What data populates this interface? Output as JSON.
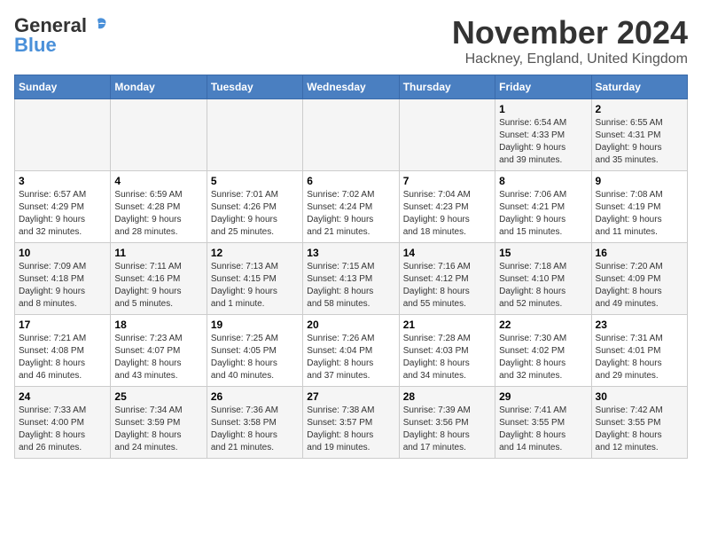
{
  "header": {
    "logo_general": "General",
    "logo_blue": "Blue",
    "title": "November 2024",
    "location": "Hackney, England, United Kingdom"
  },
  "weekdays": [
    "Sunday",
    "Monday",
    "Tuesday",
    "Wednesday",
    "Thursday",
    "Friday",
    "Saturday"
  ],
  "weeks": [
    [
      {
        "day": "",
        "info": ""
      },
      {
        "day": "",
        "info": ""
      },
      {
        "day": "",
        "info": ""
      },
      {
        "day": "",
        "info": ""
      },
      {
        "day": "",
        "info": ""
      },
      {
        "day": "1",
        "info": "Sunrise: 6:54 AM\nSunset: 4:33 PM\nDaylight: 9 hours\nand 39 minutes."
      },
      {
        "day": "2",
        "info": "Sunrise: 6:55 AM\nSunset: 4:31 PM\nDaylight: 9 hours\nand 35 minutes."
      }
    ],
    [
      {
        "day": "3",
        "info": "Sunrise: 6:57 AM\nSunset: 4:29 PM\nDaylight: 9 hours\nand 32 minutes."
      },
      {
        "day": "4",
        "info": "Sunrise: 6:59 AM\nSunset: 4:28 PM\nDaylight: 9 hours\nand 28 minutes."
      },
      {
        "day": "5",
        "info": "Sunrise: 7:01 AM\nSunset: 4:26 PM\nDaylight: 9 hours\nand 25 minutes."
      },
      {
        "day": "6",
        "info": "Sunrise: 7:02 AM\nSunset: 4:24 PM\nDaylight: 9 hours\nand 21 minutes."
      },
      {
        "day": "7",
        "info": "Sunrise: 7:04 AM\nSunset: 4:23 PM\nDaylight: 9 hours\nand 18 minutes."
      },
      {
        "day": "8",
        "info": "Sunrise: 7:06 AM\nSunset: 4:21 PM\nDaylight: 9 hours\nand 15 minutes."
      },
      {
        "day": "9",
        "info": "Sunrise: 7:08 AM\nSunset: 4:19 PM\nDaylight: 9 hours\nand 11 minutes."
      }
    ],
    [
      {
        "day": "10",
        "info": "Sunrise: 7:09 AM\nSunset: 4:18 PM\nDaylight: 9 hours\nand 8 minutes."
      },
      {
        "day": "11",
        "info": "Sunrise: 7:11 AM\nSunset: 4:16 PM\nDaylight: 9 hours\nand 5 minutes."
      },
      {
        "day": "12",
        "info": "Sunrise: 7:13 AM\nSunset: 4:15 PM\nDaylight: 9 hours\nand 1 minute."
      },
      {
        "day": "13",
        "info": "Sunrise: 7:15 AM\nSunset: 4:13 PM\nDaylight: 8 hours\nand 58 minutes."
      },
      {
        "day": "14",
        "info": "Sunrise: 7:16 AM\nSunset: 4:12 PM\nDaylight: 8 hours\nand 55 minutes."
      },
      {
        "day": "15",
        "info": "Sunrise: 7:18 AM\nSunset: 4:10 PM\nDaylight: 8 hours\nand 52 minutes."
      },
      {
        "day": "16",
        "info": "Sunrise: 7:20 AM\nSunset: 4:09 PM\nDaylight: 8 hours\nand 49 minutes."
      }
    ],
    [
      {
        "day": "17",
        "info": "Sunrise: 7:21 AM\nSunset: 4:08 PM\nDaylight: 8 hours\nand 46 minutes."
      },
      {
        "day": "18",
        "info": "Sunrise: 7:23 AM\nSunset: 4:07 PM\nDaylight: 8 hours\nand 43 minutes."
      },
      {
        "day": "19",
        "info": "Sunrise: 7:25 AM\nSunset: 4:05 PM\nDaylight: 8 hours\nand 40 minutes."
      },
      {
        "day": "20",
        "info": "Sunrise: 7:26 AM\nSunset: 4:04 PM\nDaylight: 8 hours\nand 37 minutes."
      },
      {
        "day": "21",
        "info": "Sunrise: 7:28 AM\nSunset: 4:03 PM\nDaylight: 8 hours\nand 34 minutes."
      },
      {
        "day": "22",
        "info": "Sunrise: 7:30 AM\nSunset: 4:02 PM\nDaylight: 8 hours\nand 32 minutes."
      },
      {
        "day": "23",
        "info": "Sunrise: 7:31 AM\nSunset: 4:01 PM\nDaylight: 8 hours\nand 29 minutes."
      }
    ],
    [
      {
        "day": "24",
        "info": "Sunrise: 7:33 AM\nSunset: 4:00 PM\nDaylight: 8 hours\nand 26 minutes."
      },
      {
        "day": "25",
        "info": "Sunrise: 7:34 AM\nSunset: 3:59 PM\nDaylight: 8 hours\nand 24 minutes."
      },
      {
        "day": "26",
        "info": "Sunrise: 7:36 AM\nSunset: 3:58 PM\nDaylight: 8 hours\nand 21 minutes."
      },
      {
        "day": "27",
        "info": "Sunrise: 7:38 AM\nSunset: 3:57 PM\nDaylight: 8 hours\nand 19 minutes."
      },
      {
        "day": "28",
        "info": "Sunrise: 7:39 AM\nSunset: 3:56 PM\nDaylight: 8 hours\nand 17 minutes."
      },
      {
        "day": "29",
        "info": "Sunrise: 7:41 AM\nSunset: 3:55 PM\nDaylight: 8 hours\nand 14 minutes."
      },
      {
        "day": "30",
        "info": "Sunrise: 7:42 AM\nSunset: 3:55 PM\nDaylight: 8 hours\nand 12 minutes."
      }
    ]
  ]
}
